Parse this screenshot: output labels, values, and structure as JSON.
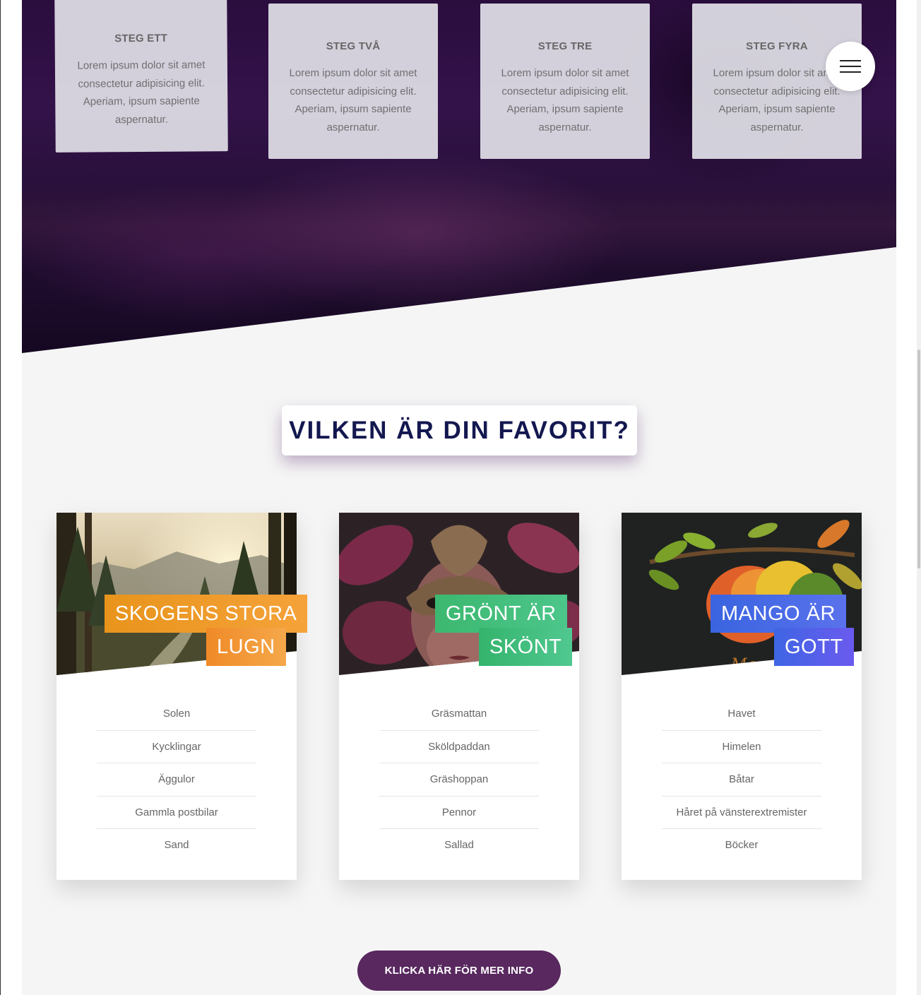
{
  "steps": [
    {
      "title": "STEG ETT",
      "text": "Lorem ipsum dolor sit amet consectetur adipisicing elit. Aperiam, ipsum sapiente aspernatur."
    },
    {
      "title": "STEG TVÅ",
      "text": "Lorem ipsum dolor sit amet consectetur adipisicing elit. Aperiam, ipsum sapiente aspernatur."
    },
    {
      "title": "STEG TRE",
      "text": "Lorem ipsum dolor sit amet consectetur adipisicing elit. Aperiam, ipsum sapiente aspernatur."
    },
    {
      "title": "STEG FYRA",
      "text": "Lorem ipsum dolor sit amet consectetur adipisicing elit. Aperiam, ipsum sapiente aspernatur."
    }
  ],
  "menu": {
    "icon": "hamburger-menu-icon"
  },
  "favorites": {
    "title": "VILKEN ÄR DIN FAVORIT?",
    "cards": [
      {
        "label_line1": "SKOGENS STORA",
        "label_line2": "LUGN",
        "accent": "#f0961e",
        "image": "forest-landscape-image",
        "items": [
          "Solen",
          "Kycklingar",
          "Äggulor",
          "Gammla postbilar",
          "Sand"
        ]
      },
      {
        "label_line1": "GRÖNT ÄR",
        "label_line2": "SKÖNT",
        "accent": "#3cbc78",
        "image": "masked-face-image",
        "items": [
          "Gräsmattan",
          "Sköldpaddan",
          "Gräshoppan",
          "Pennor",
          "Sallad"
        ]
      },
      {
        "label_line1": "MANGO ÄR",
        "label_line2": "GOTT",
        "accent": "#4a6ae8",
        "image": "mango-fruit-image",
        "items": [
          "Havet",
          "Himelen",
          "Båtar",
          "Håret på vänsterextremister",
          "Böcker"
        ]
      }
    ]
  },
  "cta": {
    "label": "KLICKA HÄR FÖR MER INFO",
    "color": "#58285f"
  },
  "colors": {
    "hero": "#2b0d3e",
    "title": "#141850",
    "background": "#f5f5f5"
  }
}
